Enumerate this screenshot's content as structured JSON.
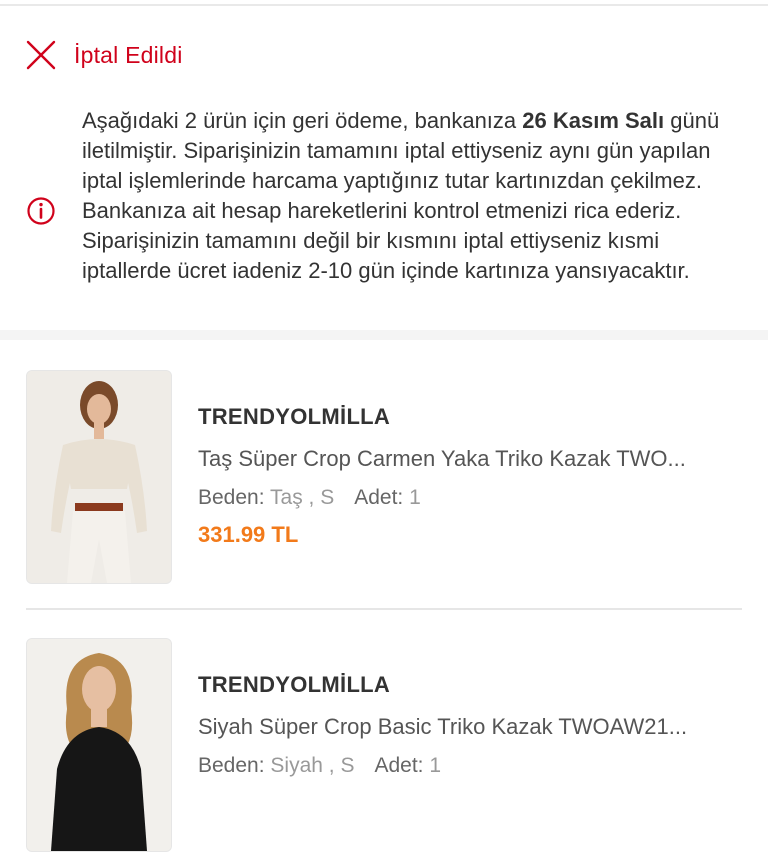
{
  "order": {
    "status_label": "İptal Edildi",
    "status_color": "#d0021b"
  },
  "refund": {
    "text_before": "Aşağıdaki 2 ürün için geri ödeme, bankanıza ",
    "date_bold": "26 Kasım Salı",
    "text_after": " günü iletilmiştir. Siparişinizin tamamını iptal ettiyseniz aynı gün yapılan iptal işlemlerinde harcama yaptığınız tutar kartınızdan çekilmez. Bankanıza ait hesap hareketlerini kontrol etmenizi rica ederiz. Siparişinizin tamamını değil bir kısmını iptal ettiyseniz kısmi iptallerde ücret iadeniz 2-10 gün içinde kartınıza yansıyacaktır."
  },
  "products": [
    {
      "brand": "TRENDYOLMİLLA",
      "name": "Taş Süper Crop Carmen Yaka Triko Kazak TWO...",
      "size_label": "Beden:",
      "size_value": "Taş , S",
      "qty_label": "Adet:",
      "qty_value": "1",
      "price": "331.99 TL"
    },
    {
      "brand": "TRENDYOLMİLLA",
      "name": "Siyah Süper Crop Basic Triko Kazak TWOAW21...",
      "size_label": "Beden:",
      "size_value": "Siyah , S",
      "qty_label": "Adet:",
      "qty_value": "1",
      "price": ""
    }
  ],
  "colors": {
    "accent_orange": "#f27a1a",
    "cancel_red": "#d0021b"
  },
  "icons": [
    "close-x-icon",
    "info-circle-icon"
  ]
}
